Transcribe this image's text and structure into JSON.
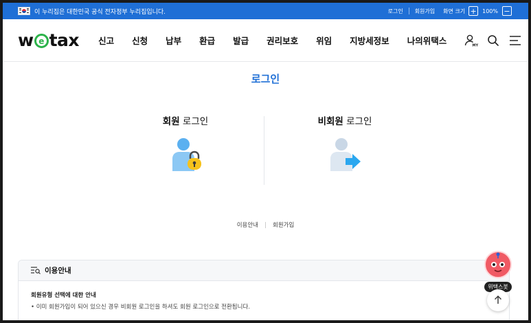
{
  "gov_banner": {
    "notice": "이 누리집은 대한민국 공식 전자정부 누리집입니다.",
    "links": [
      "로그인",
      "회원가입"
    ],
    "zoom_label": "화면 크기",
    "zoom_in": "+",
    "zoom_value": "100%",
    "zoom_out": "−",
    "bg_color": "#1f6fd6"
  },
  "header": {
    "logo_pre": "w",
    "logo_e": "e",
    "logo_post": "tax",
    "nav": [
      "신고",
      "신청",
      "납부",
      "환급",
      "발급",
      "권리보호",
      "위임",
      "지방세정보",
      "나의위택스"
    ],
    "icons": [
      "my-account-icon",
      "search-icon",
      "menu-icon"
    ],
    "my_badge": "MY"
  },
  "main": {
    "title": "로그인",
    "accent_color": "#1f6fd6",
    "member_login": {
      "bold": "회원",
      "rest": " 로그인",
      "icon": "user-lock-icon"
    },
    "guest_login": {
      "bold": "비회원",
      "rest": " 로그인",
      "icon": "user-arrow-icon"
    },
    "sub_links": [
      "이용안내",
      "회원가입"
    ]
  },
  "info": {
    "title": "이용안내",
    "subtitle": "회원유형 선택에 대한 안내",
    "desc": "• 이미 회원가입이 되어 있으신 경우 비회원 로그인을 하셔도 회원 로그인으로 전환됩니다."
  },
  "floating": {
    "chatbot_label": "위택스봇",
    "top_icon": "arrow-up-icon"
  }
}
